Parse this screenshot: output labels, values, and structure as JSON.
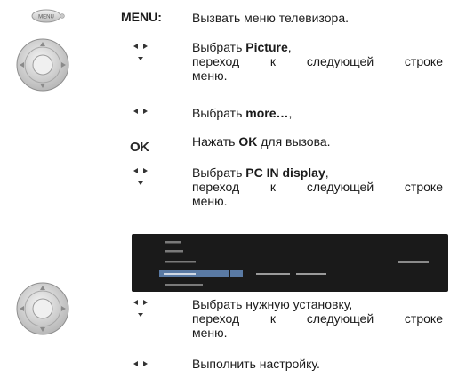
{
  "menu_step": {
    "key": "MENU:",
    "text": "Вызвать меню телевизора.",
    "remote_button": "MENU"
  },
  "steps": [
    {
      "pre": "Выбрать ",
      "bold": "Picture",
      "post": ",",
      "line2": "переход к следующей строке",
      "line3": "меню."
    },
    {
      "pre": "Выбрать ",
      "bold": "more…",
      "post": ","
    },
    {
      "pre": "Нажать ",
      "bold": "OK",
      "post": " для вызова."
    },
    {
      "pre": "Выбрать ",
      "bold": "PC IN display",
      "post": ",",
      "line2": "переход к следующей строке",
      "line3": "меню."
    },
    {
      "line1": "Выбрать нужную установку,",
      "line2": "переход к следующей строке",
      "line3": "меню."
    },
    {
      "line1": "Выполнить настройку."
    }
  ],
  "ok_label": "OK",
  "icons": [
    "remote-menu-button-icon",
    "remote-dpad-icon",
    "left-right-arrows-icon",
    "down-arrow-icon",
    "tv-osd-screenshot"
  ],
  "colors": {
    "osd_bg": "#1a1a1a",
    "osd_highlight": "#5a7aa4",
    "text": "#1a1a1a"
  }
}
